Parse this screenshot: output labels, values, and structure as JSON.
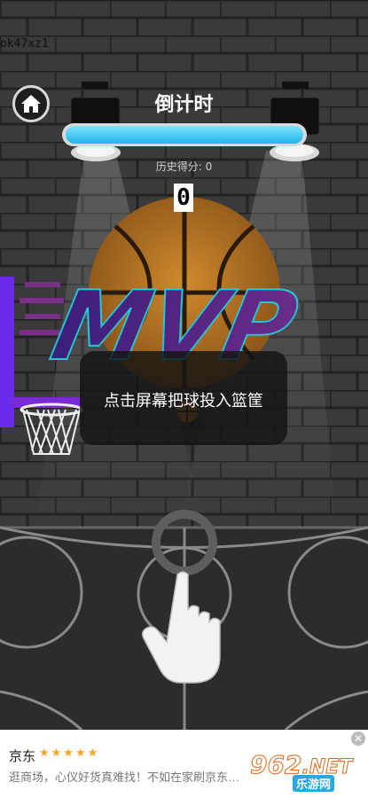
{
  "user": {
    "tag": "ok47xz1"
  },
  "header": {
    "title": "倒计时",
    "home_icon": "home-icon"
  },
  "timer": {
    "progress": 1.0,
    "fill_color": "#2cc3f0"
  },
  "stats": {
    "history_label": "历史得分: 0",
    "score": "0"
  },
  "banner": {
    "text": "MVP"
  },
  "tip": {
    "text": "点击屏幕把球投入篮筐"
  },
  "ad": {
    "brand": "京东",
    "stars": "★★★★★",
    "description": "逛商场，心仪好货真难找！不如在家刷京东…",
    "close": "✕"
  },
  "watermark": {
    "number": "962",
    "dot_net": ".NET",
    "site": "乐游网"
  },
  "colors": {
    "accent": "#2cc3f0",
    "mvp": "#5a2c86",
    "hoop_board": "#7b2bd6"
  }
}
